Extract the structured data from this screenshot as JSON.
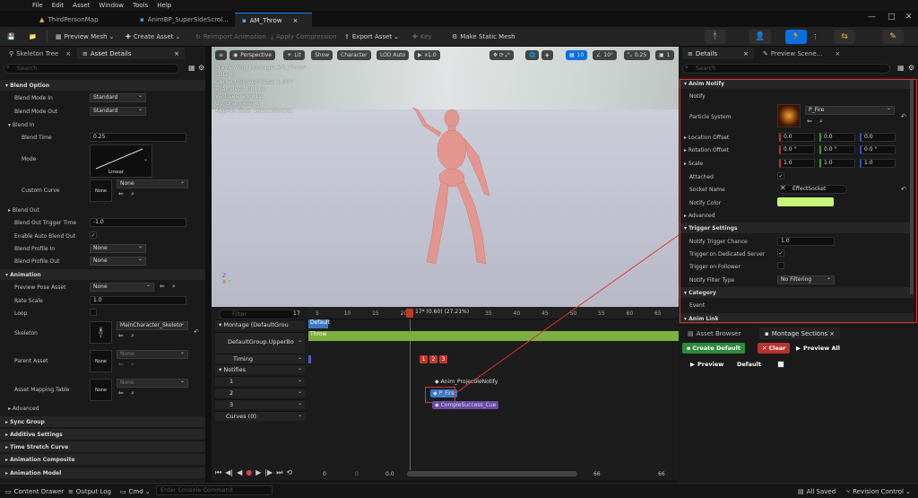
{
  "menu": [
    "File",
    "Edit",
    "Asset",
    "Window",
    "Tools",
    "Help"
  ],
  "tabs": [
    "ThirdPersonMap",
    "AnimBP_SuperSideScrol...",
    "AM_Throw"
  ],
  "toolbar": {
    "preview_mesh": "Preview Mesh",
    "create_asset": "Create Asset",
    "reimport": "Reimport Animation",
    "apply_compression": "Apply Compression",
    "export_asset": "Export Asset",
    "key": "Key",
    "make_static_mesh": "Make Static Mesh"
  },
  "left": {
    "tab1": "Skeleton Tree",
    "tab2": "Asset Details",
    "search_placeholder": "Search",
    "sections": {
      "blend_option": "Blend Option",
      "animation": "Animation",
      "advanced": "Advanced",
      "sync_group": "Sync Group",
      "additive": "Additive Settings",
      "time_stretch": "Time Stretch Curve",
      "composite": "Animation Composite",
      "model": "Animation Model"
    },
    "labels": {
      "blend_mode_in": "Blend Mode In",
      "blend_mode_out": "Blend Mode Out",
      "blend_in": "Blend In",
      "blend_time": "Blend Time",
      "mode": "Mode",
      "custom_curve": "Custom Curve",
      "blend_out": "Blend Out",
      "blend_out_trigger": "Blend Out Trigger Time",
      "enable_auto_blend": "Enable Auto Blend Out",
      "blend_profile_in": "Blend Profile In",
      "blend_profile_out": "Blend Profile Out",
      "preview_pose": "Preview Pose Asset",
      "rate_scale": "Rate Scale",
      "loop": "Loop",
      "skeleton": "Skeleton",
      "parent_asset": "Parent Asset",
      "asset_mapping": "Asset Mapping Table"
    },
    "values": {
      "standard": "Standard",
      "blend_time": "0.25",
      "linear": "Linear",
      "none": "None",
      "trigger_time": "-1.0",
      "rate_scale": "1.0",
      "skeleton_name": "MainCharacter_Skeleto"
    }
  },
  "viewport": {
    "perspective": "Perspective",
    "lit": "Lit",
    "show": "Show",
    "character": "Character",
    "lod": "LOD Auto",
    "speed": "x1.0",
    "grid": "10",
    "angle": "10°",
    "cam": "0.25",
    "layers": "1",
    "stats": [
      "Previewing Montage AM_Throw",
      "LOD: 0",
      "Current Screen Size: 1.007",
      "Triangles: 49,112",
      "Vertices: 28,312",
      "UV Channels: 1",
      "Approx Size: 181x109x181"
    ]
  },
  "timeline": {
    "filter": "Filter",
    "count": "17",
    "playhead": "17* (0.60) (27.21%)",
    "ticks": [
      "5",
      "10",
      "15",
      "20",
      "25",
      "30",
      "35",
      "40",
      "45",
      "50",
      "55",
      "60",
      "65"
    ],
    "montage_label": "Montage (DefaultGrou",
    "default_slot": "Default",
    "group_label": "DefaultGroup.UpperBo",
    "throw": "Throw",
    "timing": "Timing",
    "notifies": "Notifies",
    "tracks": [
      "1",
      "2",
      "3"
    ],
    "curves": "Curves",
    "curves_count": "(0)",
    "sections": [
      "1",
      "2",
      "3"
    ],
    "notify_items": [
      "Anim_ProjectileNotify",
      "P_Fire",
      "CompleSuccess_Cue"
    ],
    "bottom_nums": [
      "0",
      "0",
      "0.0",
      "66",
      "66"
    ]
  },
  "details": {
    "tab1": "Details",
    "tab2": "Preview Scene...",
    "search_placeholder": "Search",
    "anim_notify": "Anim Notify",
    "notify": "Notify",
    "particle_system": "Particle System",
    "ps_value": "P_Fire",
    "location_offset": "Location Offset",
    "rotation_offset": "Rotation Offset",
    "scale": "Scale",
    "loc_vals": [
      "0.0",
      "0.0",
      "0.0"
    ],
    "rot_vals": [
      "0.0 °",
      "0.0 °",
      "0.0 °"
    ],
    "scale_vals": [
      "1.0",
      "1.0",
      "1.0"
    ],
    "attached": "Attached",
    "socket_name": "Socket Name",
    "socket_value": "EffectSocket",
    "notify_color": "Notify Color",
    "notify_color_hex": "#c8f878",
    "advanced": "Advanced",
    "trigger_settings": "Trigger Settings",
    "trigger_chance": "Notify Trigger Chance",
    "trigger_chance_val": "1.0",
    "dedicated_server": "Trigger on Dedicated Server",
    "on_follower": "Trigger on Follower",
    "filter_type": "Notify Filter Type",
    "filter_val": "No Filtering",
    "category": "Category",
    "event": "Event",
    "anim_link": "Anim Link"
  },
  "asset_browser": {
    "tab1": "Asset Browser",
    "tab2": "Montage Sections",
    "create_default": "Create Default",
    "clear": "Clear",
    "preview_all": "Preview All",
    "preview": "Preview",
    "default": "Default"
  },
  "status": {
    "content_drawer": "Content Drawer",
    "output_log": "Output Log",
    "cmd": "Cmd",
    "console_placeholder": "Enter Console Command",
    "all_saved": "All Saved",
    "revision": "Revision Control"
  }
}
